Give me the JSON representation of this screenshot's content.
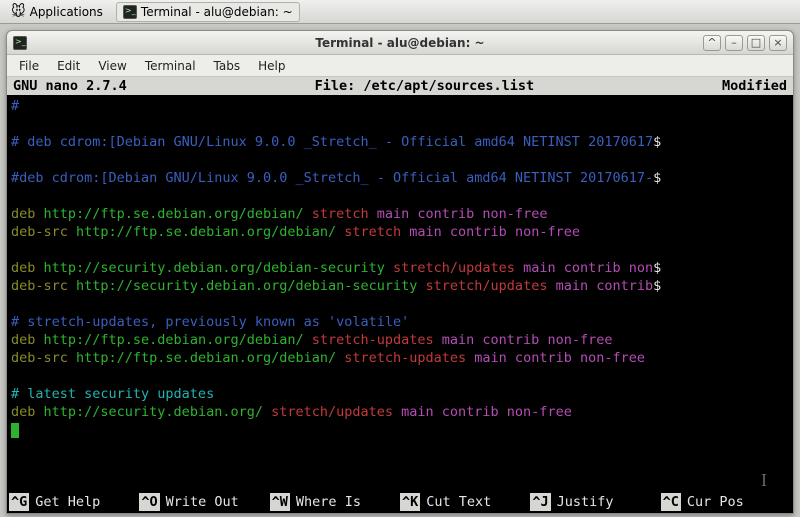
{
  "panel": {
    "applications_label": "Applications",
    "task_label": "Terminal - alu@debian: ~"
  },
  "window": {
    "title": "Terminal - alu@debian: ~",
    "menu": [
      "File",
      "Edit",
      "View",
      "Terminal",
      "Tabs",
      "Help"
    ],
    "controls": {
      "min": "–",
      "max": "□",
      "close": "×",
      "aux": "^"
    }
  },
  "nano": {
    "version": "GNU nano 2.7.4",
    "file_label": "File: /etc/apt/sources.list",
    "status": "Modified",
    "shortcuts": [
      {
        "key": "^G",
        "label": "Get Help"
      },
      {
        "key": "^O",
        "label": "Write Out"
      },
      {
        "key": "^W",
        "label": "Where Is"
      },
      {
        "key": "^K",
        "label": "Cut Text"
      },
      {
        "key": "^J",
        "label": "Justify"
      },
      {
        "key": "^C",
        "label": "Cur Pos"
      }
    ]
  },
  "editor_lines": [
    [
      {
        "cls": "c-blue",
        "t": "#"
      }
    ],
    [],
    [
      {
        "cls": "c-blue",
        "t": "# deb cdrom:[Debian GNU/Linux 9.0.0 _Stretch_ - Official amd64 NETINST 20170617"
      },
      {
        "cls": "c-white",
        "t": "$"
      }
    ],
    [],
    [
      {
        "cls": "c-blue",
        "t": "#deb cdrom:[Debian GNU/Linux 9.0.0 _Stretch_ - Official amd64 NETINST 20170617-"
      },
      {
        "cls": "c-white",
        "t": "$"
      }
    ],
    [],
    [
      {
        "cls": "c-olive",
        "t": "deb "
      },
      {
        "cls": "c-green",
        "t": "http://ftp.se.debian.org/debian/ "
      },
      {
        "cls": "c-red",
        "t": "stretch "
      },
      {
        "cls": "c-mag",
        "t": "main contrib non-free"
      }
    ],
    [
      {
        "cls": "c-olive",
        "t": "deb-src "
      },
      {
        "cls": "c-green",
        "t": "http://ftp.se.debian.org/debian/ "
      },
      {
        "cls": "c-red",
        "t": "stretch "
      },
      {
        "cls": "c-mag",
        "t": "main contrib non-free"
      }
    ],
    [],
    [
      {
        "cls": "c-olive",
        "t": "deb "
      },
      {
        "cls": "c-green",
        "t": "http://security.debian.org/debian-security "
      },
      {
        "cls": "c-red",
        "t": "stretch/updates "
      },
      {
        "cls": "c-mag",
        "t": "main contrib non"
      },
      {
        "cls": "c-white",
        "t": "$"
      }
    ],
    [
      {
        "cls": "c-olive",
        "t": "deb-src "
      },
      {
        "cls": "c-green",
        "t": "http://security.debian.org/debian-security "
      },
      {
        "cls": "c-red",
        "t": "stretch/updates "
      },
      {
        "cls": "c-mag",
        "t": "main contrib"
      },
      {
        "cls": "c-white",
        "t": "$"
      }
    ],
    [],
    [
      {
        "cls": "c-blue",
        "t": "# stretch-updates, previously known as 'volatile'"
      }
    ],
    [
      {
        "cls": "c-olive",
        "t": "deb "
      },
      {
        "cls": "c-green",
        "t": "http://ftp.se.debian.org/debian/ "
      },
      {
        "cls": "c-red",
        "t": "stretch-updates "
      },
      {
        "cls": "c-mag",
        "t": "main contrib non-free"
      }
    ],
    [
      {
        "cls": "c-olive",
        "t": "deb-src "
      },
      {
        "cls": "c-green",
        "t": "http://ftp.se.debian.org/debian/ "
      },
      {
        "cls": "c-red",
        "t": "stretch-updates "
      },
      {
        "cls": "c-mag",
        "t": "main contrib non-free"
      }
    ],
    [],
    [
      {
        "cls": "c-cyan",
        "t": "# latest security updates"
      }
    ],
    [
      {
        "cls": "c-olive",
        "t": "deb "
      },
      {
        "cls": "c-green",
        "t": "http://security.debian.org/ "
      },
      {
        "cls": "c-red",
        "t": "stretch/updates "
      },
      {
        "cls": "c-mag",
        "t": "main contrib non-free"
      }
    ]
  ]
}
